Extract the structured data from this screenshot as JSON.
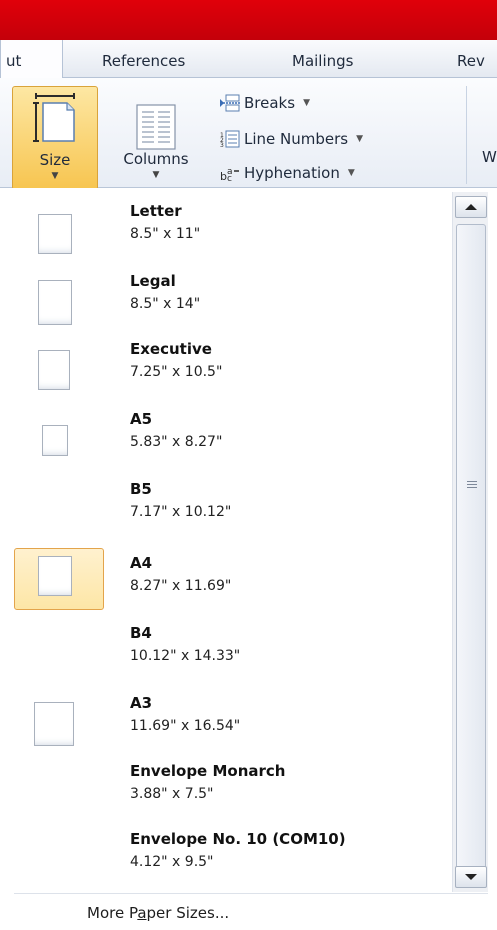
{
  "tabs": {
    "partial_left": "ut",
    "references": "References",
    "mailings": "Mailings",
    "partial_right": "Rev"
  },
  "ribbon": {
    "size_label": "Size",
    "columns_label": "Columns",
    "breaks_label": "Breaks",
    "line_numbers_label": "Line Numbers",
    "hyphenation_label": "Hyphenation",
    "partial_right": "W"
  },
  "paper_sizes": [
    {
      "name": "Letter",
      "dims": "8.5\" x 11\""
    },
    {
      "name": "Legal",
      "dims": "8.5\" x 14\""
    },
    {
      "name": "Executive",
      "dims": "7.25\" x 10.5\""
    },
    {
      "name": "A5",
      "dims": "5.83\" x 8.27\""
    },
    {
      "name": "B5",
      "dims": "7.17\" x 10.12\""
    },
    {
      "name": "A4",
      "dims": "8.27\" x 11.69\""
    },
    {
      "name": "B4",
      "dims": "10.12\" x 14.33\""
    },
    {
      "name": "A3",
      "dims": "11.69\" x 16.54\""
    },
    {
      "name": "Envelope Monarch",
      "dims": "3.88\" x 7.5\""
    },
    {
      "name": "Envelope No. 10 (COM10)",
      "dims": "4.12\" x 9.5\""
    }
  ],
  "selected_size": "A4",
  "more_sizes": {
    "before": "More P",
    "accel": "a",
    "after": "per Sizes..."
  },
  "colors": {
    "title_bar": "#d0000a",
    "selected_highlight": "#fde6a6",
    "selected_border": "#e3a44b"
  },
  "icons": [
    "size-icon",
    "columns-icon",
    "breaks-icon",
    "line-numbers-icon",
    "hyphenation-icon",
    "scroll-up-icon",
    "scroll-down-icon"
  ]
}
